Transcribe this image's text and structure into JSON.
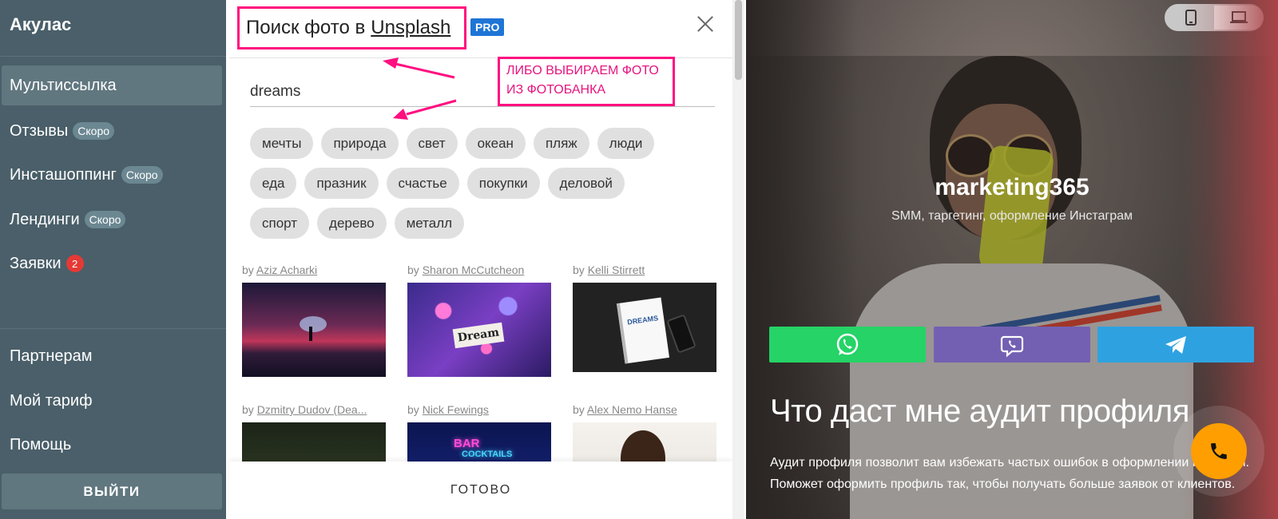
{
  "sidebar": {
    "brand": "Акулас",
    "items": [
      {
        "label": "Мультиссылка"
      },
      {
        "label": "Отзывы",
        "badge": "Скоро"
      },
      {
        "label": "Инсташоппинг",
        "badge": "Скоро"
      },
      {
        "label": "Лендинги",
        "badge": "Скоро"
      },
      {
        "label": "Заявки",
        "count": "2"
      }
    ],
    "bottom_items": [
      {
        "label": "Партнерам"
      },
      {
        "label": "Мой тариф"
      },
      {
        "label": "Помощь"
      }
    ],
    "logout_label": "ВЫЙТИ"
  },
  "modal": {
    "title_prefix": "Поиск фото в",
    "title_link": "Unsplash",
    "pro_badge": "PRO",
    "search_value": "dreams",
    "annotation": {
      "line1": "ЛИБО ВЫБИРАЕМ ФОТО",
      "line2": "ИЗ ФОТОБАНКА"
    },
    "tags": [
      [
        "мечты",
        "природа",
        "свет",
        "океан",
        "пляж",
        "люди"
      ],
      [
        "еда",
        "празник",
        "счастье",
        "покупки",
        "деловой"
      ],
      [
        "спорт",
        "дерево",
        "металл"
      ]
    ],
    "by_label": "by",
    "photos": [
      {
        "author": "Aziz Acharki"
      },
      {
        "author": "Sharon McCutcheon",
        "card_text": "Dream"
      },
      {
        "author": "Kelli Stirrett",
        "card_text": "DREAMS"
      },
      {
        "author": "Dzmitry Dudov (Dea..."
      },
      {
        "author": "Nick Fewings",
        "card_text": "BAR",
        "card_text2": "COCKTAILS"
      },
      {
        "author": "Alex Nemo Hanse"
      }
    ],
    "done_label": "ГОТОВО"
  },
  "preview": {
    "name": "marketing365",
    "description": "SMM, таргетинг, оформление Инстаграм",
    "heading": "Что даст мне аудит профиля",
    "text": "Аудит профиля позволит вам избежать частых ошибок в оформлении профиля. Поможет оформить профиль так, чтобы получать больше заявок от клиентов."
  },
  "colors": {
    "sidebar_bg": "#4a5f69",
    "annotation": "#ff0f80",
    "pro_badge": "#1e75d6",
    "whatsapp": "#25d366",
    "viber": "#7360b3",
    "telegram": "#2ea2e0",
    "call_button": "#ff9e00"
  }
}
